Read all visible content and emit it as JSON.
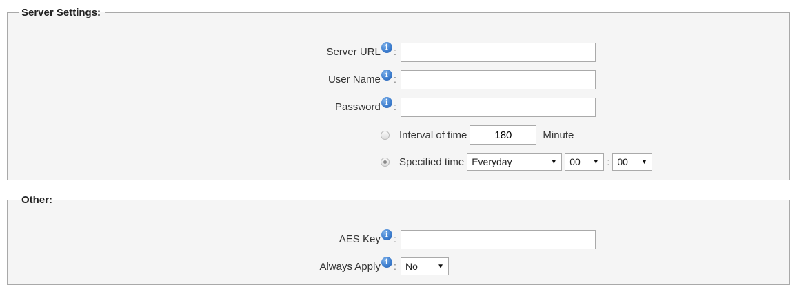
{
  "server_settings": {
    "legend": "Server Settings:",
    "server_url": {
      "label": "Server URL",
      "value": ""
    },
    "user_name": {
      "label": "User Name",
      "value": ""
    },
    "password": {
      "label": "Password",
      "value": ""
    },
    "interval": {
      "label": "Interval of time",
      "value": "180",
      "unit": "Minute",
      "selected": false
    },
    "specified": {
      "label": "Specified time",
      "selected": true,
      "frequency": "Everyday",
      "hour": "00",
      "minute": "00",
      "separator": ":"
    }
  },
  "other": {
    "legend": "Other:",
    "aes_key": {
      "label": "AES Key",
      "value": ""
    },
    "always_apply": {
      "label": "Always Apply",
      "value": "No"
    }
  },
  "common": {
    "colon": ":",
    "info_glyph": "i",
    "dropdown_arrow": "▼"
  },
  "icons": {
    "info": "info-icon",
    "dropdown": "chevron-down-icon",
    "info_color": "#3f7fcf"
  }
}
